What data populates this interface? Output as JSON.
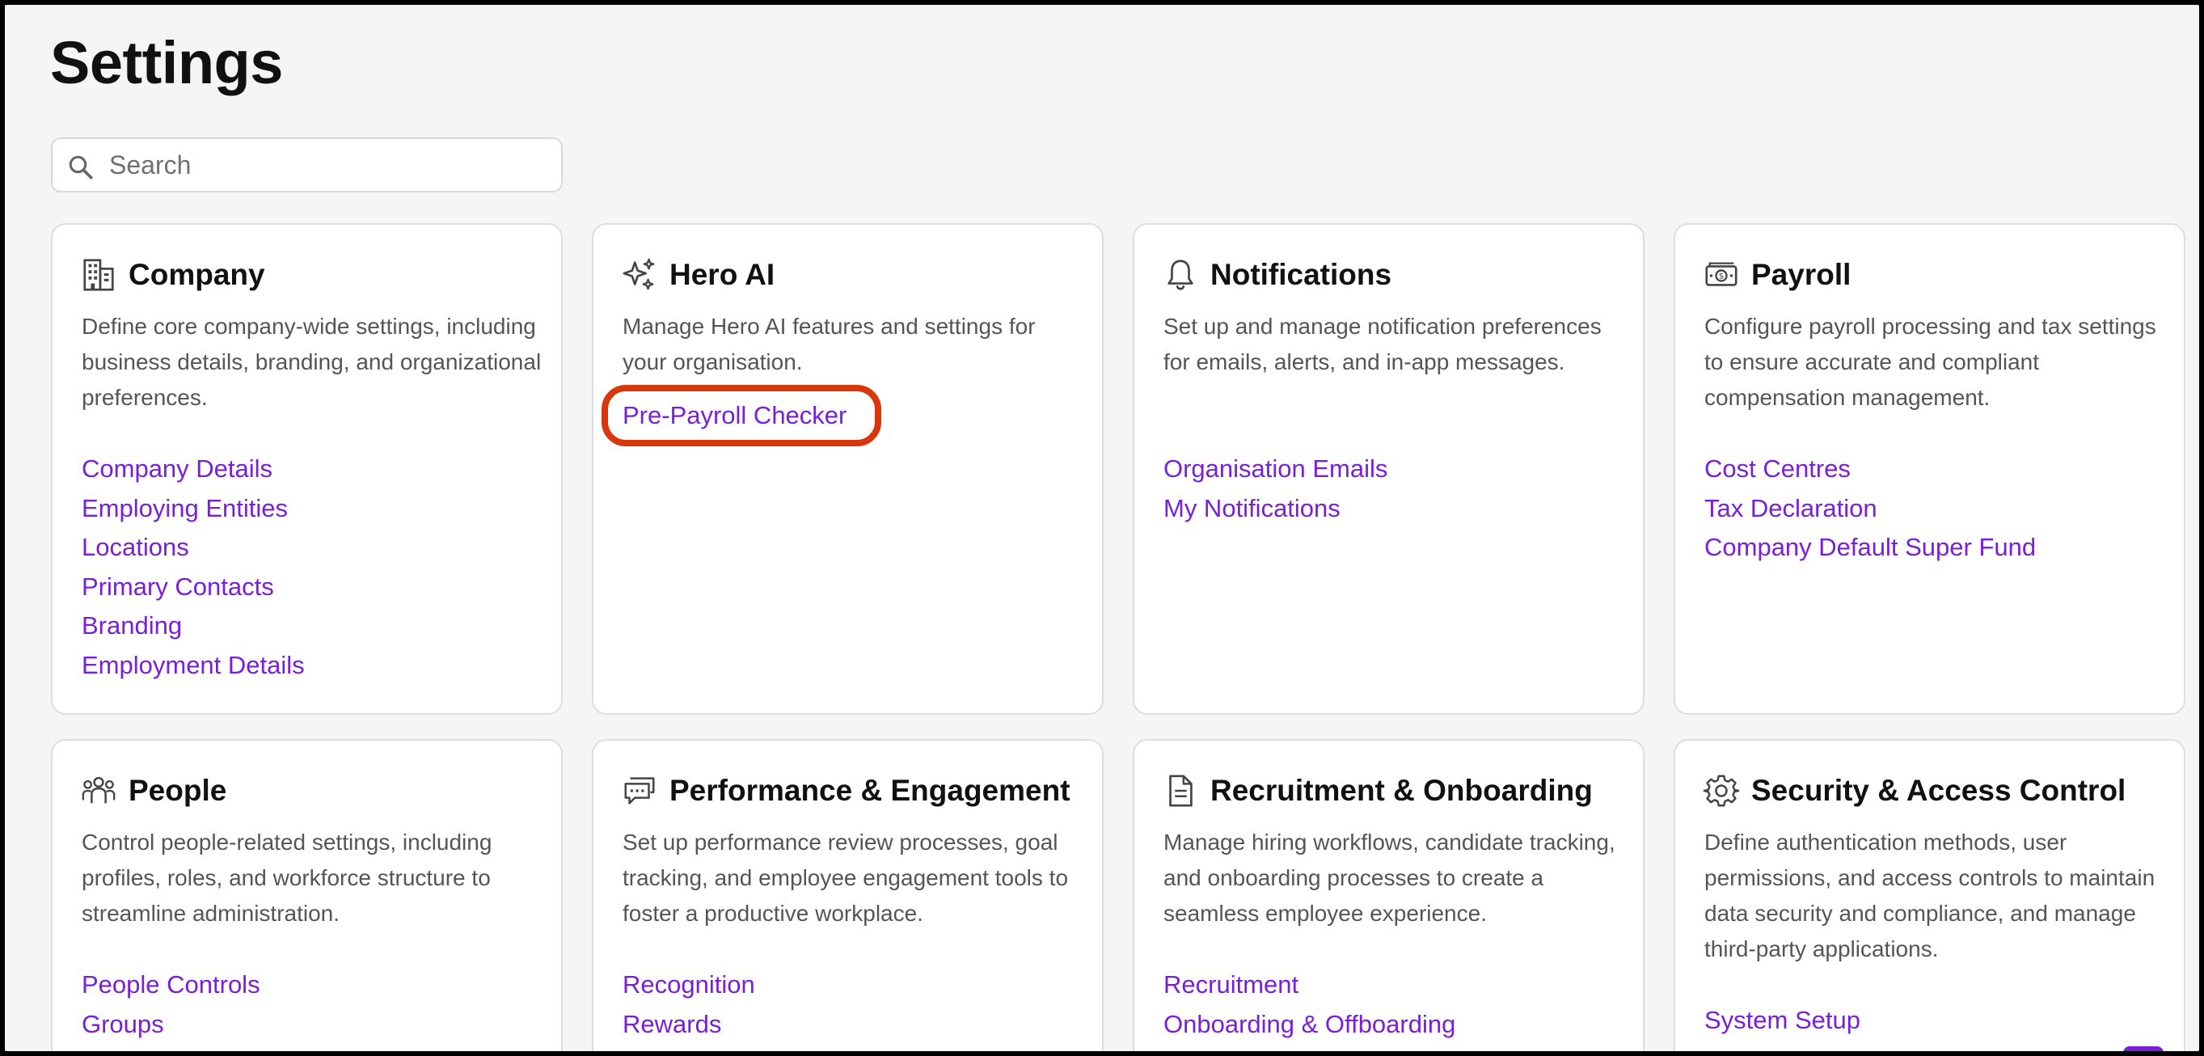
{
  "page": {
    "title": "Settings"
  },
  "search": {
    "placeholder": "Search"
  },
  "colors": {
    "accent": "#7a1fd6",
    "highlight": "#d9360c",
    "background": "#f5f5f5"
  },
  "cards": [
    {
      "title": "Company",
      "icon": "building-icon",
      "description": "Define core company-wide settings, including business details, branding, and organizational preferences.",
      "links": [
        "Company Details",
        "Employing Entities",
        "Locations",
        "Primary Contacts",
        "Branding",
        "Employment Details"
      ]
    },
    {
      "title": "Hero AI",
      "icon": "sparkles-icon",
      "description": "Manage Hero AI features and settings for your organisation.",
      "links": [
        "Pre-Payroll Checker"
      ]
    },
    {
      "title": "Notifications",
      "icon": "bell-icon",
      "description": "Set up and manage notification preferences for emails, alerts, and in-app messages.",
      "links": [
        "Organisation Emails",
        "My Notifications"
      ]
    },
    {
      "title": "Payroll",
      "icon": "money-icon",
      "description": "Configure payroll processing and tax settings to ensure accurate and compliant compensation management.",
      "links": [
        "Cost Centres",
        "Tax Declaration",
        "Company Default Super Fund"
      ]
    },
    {
      "title": "People",
      "icon": "people-icon",
      "description": "Control people-related settings, including profiles, roles, and workforce structure to streamline administration.",
      "links": [
        "People Controls",
        "Groups"
      ]
    },
    {
      "title": "Performance & Engagement",
      "icon": "chat-icon",
      "description": "Set up performance review processes, goal tracking, and employee engagement tools to foster a productive workplace.",
      "links": [
        "Recognition",
        "Rewards"
      ]
    },
    {
      "title": "Recruitment & Onboarding",
      "icon": "document-icon",
      "description": "Manage hiring workflows, candidate tracking, and onboarding processes to create a seamless employee experience.",
      "links": [
        "Recruitment",
        "Onboarding & Offboarding"
      ]
    },
    {
      "title": "Security & Access Control",
      "icon": "gear-icon",
      "description": "Define authentication methods, user permissions, and access controls to maintain data security and compliance, and manage third-party applications.",
      "links": [
        "System Setup"
      ]
    }
  ]
}
